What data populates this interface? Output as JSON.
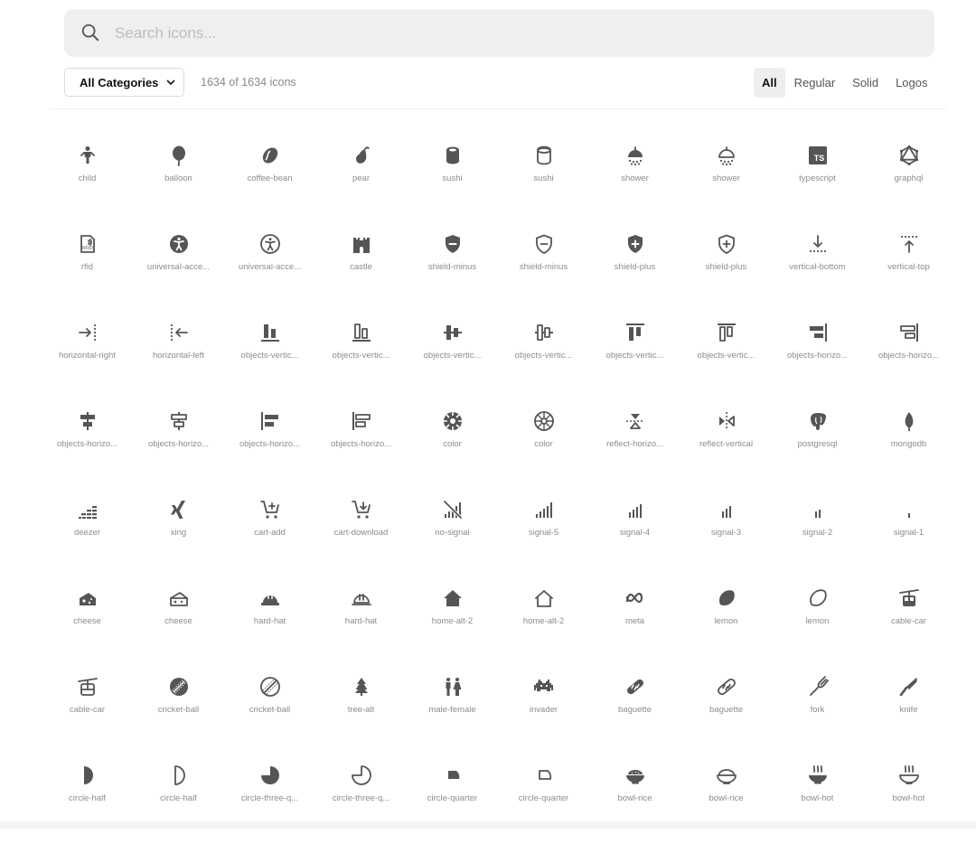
{
  "search": {
    "placeholder": "Search icons..."
  },
  "category": {
    "label": "All Categories"
  },
  "count": "1634 of 1634 icons",
  "tabs": [
    {
      "label": "All",
      "active": true
    },
    {
      "label": "Regular",
      "active": false
    },
    {
      "label": "Solid",
      "active": false
    },
    {
      "label": "Logos",
      "active": false
    }
  ],
  "colors": {
    "icon": "#555555",
    "label": "#8c8c8c",
    "search_bg": "#efefef"
  },
  "icons": [
    {
      "label": "child",
      "icon": "child-icon",
      "style": "solid"
    },
    {
      "label": "balloon",
      "icon": "balloon-icon",
      "style": "solid"
    },
    {
      "label": "coffee-bean",
      "icon": "coffee-bean-icon",
      "style": "solid"
    },
    {
      "label": "pear",
      "icon": "pear-icon",
      "style": "solid"
    },
    {
      "label": "sushi",
      "icon": "sushi-icon",
      "style": "solid"
    },
    {
      "label": "sushi",
      "icon": "sushi-icon",
      "style": "regular"
    },
    {
      "label": "shower",
      "icon": "shower-icon",
      "style": "solid"
    },
    {
      "label": "shower",
      "icon": "shower-icon",
      "style": "regular"
    },
    {
      "label": "typescript",
      "icon": "typescript-icon",
      "style": "logo"
    },
    {
      "label": "graphql",
      "icon": "graphql-icon",
      "style": "logo"
    },
    {
      "label": "rfid",
      "icon": "rfid-icon",
      "style": "regular"
    },
    {
      "label": "universal-acce...",
      "icon": "universal-access-icon",
      "style": "solid"
    },
    {
      "label": "universal-acce...",
      "icon": "universal-access-icon",
      "style": "regular"
    },
    {
      "label": "castle",
      "icon": "castle-icon",
      "style": "solid"
    },
    {
      "label": "shield-minus",
      "icon": "shield-minus-icon",
      "style": "solid"
    },
    {
      "label": "shield-minus",
      "icon": "shield-minus-icon",
      "style": "regular"
    },
    {
      "label": "shield-plus",
      "icon": "shield-plus-icon",
      "style": "solid"
    },
    {
      "label": "shield-plus",
      "icon": "shield-plus-icon",
      "style": "regular"
    },
    {
      "label": "vertical-bottom",
      "icon": "vertical-bottom-icon",
      "style": "regular"
    },
    {
      "label": "vertical-top",
      "icon": "vertical-top-icon",
      "style": "regular"
    },
    {
      "label": "horizontal-right",
      "icon": "horizontal-right-icon",
      "style": "regular"
    },
    {
      "label": "horizontal-left",
      "icon": "horizontal-left-icon",
      "style": "regular"
    },
    {
      "label": "objects-vertic...",
      "icon": "objects-vertical-bottom-icon",
      "style": "solid"
    },
    {
      "label": "objects-vertic...",
      "icon": "objects-vertical-bottom-icon",
      "style": "regular"
    },
    {
      "label": "objects-vertic...",
      "icon": "objects-vertical-center-icon",
      "style": "solid"
    },
    {
      "label": "objects-vertic...",
      "icon": "objects-vertical-center-icon",
      "style": "regular"
    },
    {
      "label": "objects-vertic...",
      "icon": "objects-vertical-top-icon",
      "style": "solid"
    },
    {
      "label": "objects-vertic...",
      "icon": "objects-vertical-top-icon",
      "style": "regular"
    },
    {
      "label": "objects-horizo...",
      "icon": "objects-horizontal-right-icon",
      "style": "solid"
    },
    {
      "label": "objects-horizo...",
      "icon": "objects-horizontal-right-icon",
      "style": "regular"
    },
    {
      "label": "objects-horizo...",
      "icon": "objects-horizontal-center-icon",
      "style": "solid"
    },
    {
      "label": "objects-horizo...",
      "icon": "objects-horizontal-center-icon",
      "style": "regular"
    },
    {
      "label": "objects-horizo...",
      "icon": "objects-horizontal-left-icon",
      "style": "solid"
    },
    {
      "label": "objects-horizo...",
      "icon": "objects-horizontal-left-icon",
      "style": "regular"
    },
    {
      "label": "color",
      "icon": "color-icon",
      "style": "solid"
    },
    {
      "label": "color",
      "icon": "color-icon",
      "style": "regular"
    },
    {
      "label": "reflect-horizo...",
      "icon": "reflect-horizontal-icon",
      "style": "regular"
    },
    {
      "label": "reflect-vertical",
      "icon": "reflect-vertical-icon",
      "style": "regular"
    },
    {
      "label": "postgresql",
      "icon": "postgresql-icon",
      "style": "logo"
    },
    {
      "label": "mongodb",
      "icon": "mongodb-icon",
      "style": "logo"
    },
    {
      "label": "deezer",
      "icon": "deezer-icon",
      "style": "logo"
    },
    {
      "label": "xing",
      "icon": "xing-icon",
      "style": "logo"
    },
    {
      "label": "cart-add",
      "icon": "cart-add-icon",
      "style": "regular"
    },
    {
      "label": "cart-download",
      "icon": "cart-download-icon",
      "style": "regular"
    },
    {
      "label": "no-signal",
      "icon": "no-signal-icon",
      "style": "regular"
    },
    {
      "label": "signal-5",
      "icon": "signal-5-icon",
      "style": "regular"
    },
    {
      "label": "signal-4",
      "icon": "signal-4-icon",
      "style": "regular"
    },
    {
      "label": "signal-3",
      "icon": "signal-3-icon",
      "style": "regular"
    },
    {
      "label": "signal-2",
      "icon": "signal-2-icon",
      "style": "regular"
    },
    {
      "label": "signal-1",
      "icon": "signal-1-icon",
      "style": "regular"
    },
    {
      "label": "cheese",
      "icon": "cheese-icon",
      "style": "solid"
    },
    {
      "label": "cheese",
      "icon": "cheese-icon",
      "style": "regular"
    },
    {
      "label": "hard-hat",
      "icon": "hard-hat-icon",
      "style": "solid"
    },
    {
      "label": "hard-hat",
      "icon": "hard-hat-icon",
      "style": "regular"
    },
    {
      "label": "home-alt-2",
      "icon": "home-alt-2-icon",
      "style": "solid"
    },
    {
      "label": "home-alt-2",
      "icon": "home-alt-2-icon",
      "style": "regular"
    },
    {
      "label": "meta",
      "icon": "meta-icon",
      "style": "logo"
    },
    {
      "label": "lemon",
      "icon": "lemon-icon",
      "style": "solid"
    },
    {
      "label": "lemon",
      "icon": "lemon-icon",
      "style": "regular"
    },
    {
      "label": "cable-car",
      "icon": "cable-car-icon",
      "style": "solid"
    },
    {
      "label": "cable-car",
      "icon": "cable-car-icon",
      "style": "regular"
    },
    {
      "label": "cricket-ball",
      "icon": "cricket-ball-icon",
      "style": "solid"
    },
    {
      "label": "cricket-ball",
      "icon": "cricket-ball-icon",
      "style": "regular"
    },
    {
      "label": "tree-alt",
      "icon": "tree-alt-icon",
      "style": "solid"
    },
    {
      "label": "male-female",
      "icon": "male-female-icon",
      "style": "solid"
    },
    {
      "label": "invader",
      "icon": "invader-icon",
      "style": "solid"
    },
    {
      "label": "baguette",
      "icon": "baguette-icon",
      "style": "solid"
    },
    {
      "label": "baguette",
      "icon": "baguette-icon",
      "style": "regular"
    },
    {
      "label": "fork",
      "icon": "fork-icon",
      "style": "regular"
    },
    {
      "label": "knife",
      "icon": "knife-icon",
      "style": "solid"
    },
    {
      "label": "circle-half",
      "icon": "circle-half-icon",
      "style": "solid"
    },
    {
      "label": "circle-half",
      "icon": "circle-half-icon",
      "style": "regular"
    },
    {
      "label": "circle-three-q...",
      "icon": "circle-three-quarter-icon",
      "style": "solid"
    },
    {
      "label": "circle-three-q...",
      "icon": "circle-three-quarter-icon",
      "style": "regular"
    },
    {
      "label": "circle-quarter",
      "icon": "circle-quarter-icon",
      "style": "solid"
    },
    {
      "label": "circle-quarter",
      "icon": "circle-quarter-icon",
      "style": "regular"
    },
    {
      "label": "bowl-rice",
      "icon": "bowl-rice-icon",
      "style": "solid"
    },
    {
      "label": "bowl-rice",
      "icon": "bowl-rice-icon",
      "style": "regular"
    },
    {
      "label": "bowl-hot",
      "icon": "bowl-hot-icon",
      "style": "solid"
    },
    {
      "label": "bowl-hot",
      "icon": "bowl-hot-icon",
      "style": "regular"
    }
  ]
}
